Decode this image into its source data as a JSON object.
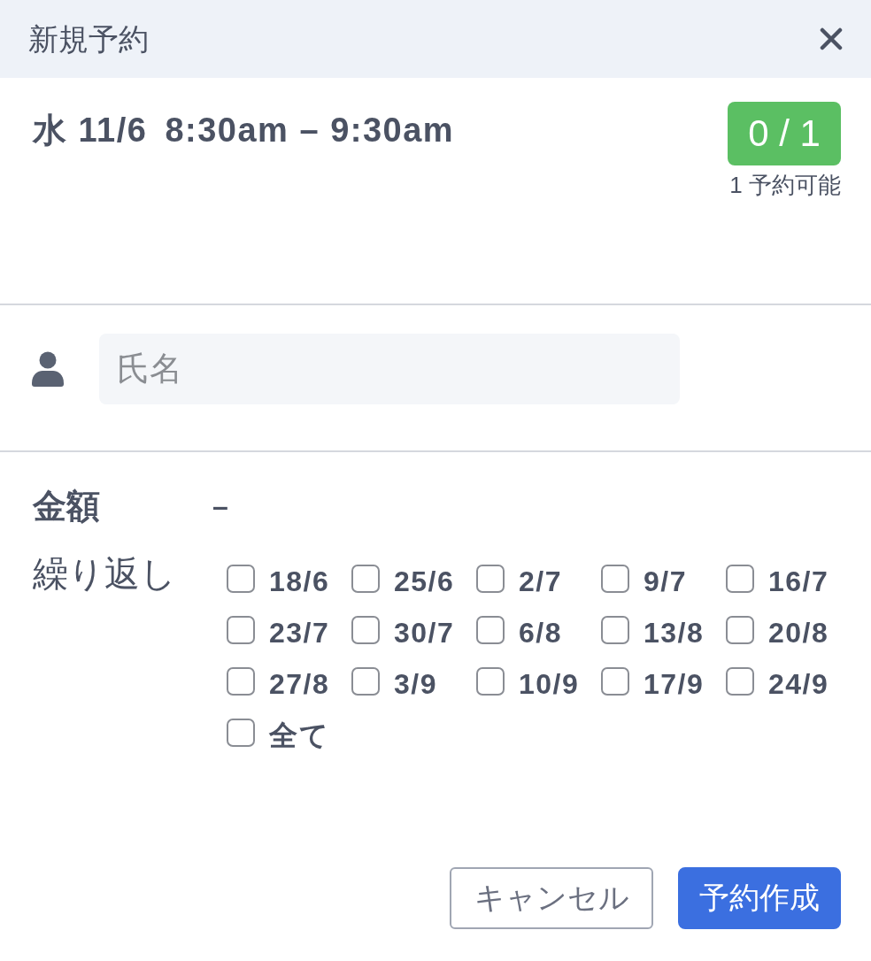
{
  "dialog": {
    "title": "新規予約"
  },
  "slot": {
    "date": "水 11/6",
    "time": "8:30am – 9:30am",
    "capacity": {
      "count": "0 / 1",
      "note": "1 予約可能"
    }
  },
  "name_field": {
    "placeholder": "氏名"
  },
  "amount": {
    "label": "金額",
    "value": "–"
  },
  "repeat": {
    "label": "繰り返し",
    "options": [
      {
        "label": "18/6",
        "checked": false
      },
      {
        "label": "25/6",
        "checked": false
      },
      {
        "label": "2/7",
        "checked": false
      },
      {
        "label": "9/7",
        "checked": false
      },
      {
        "label": "16/7",
        "checked": false
      },
      {
        "label": "23/7",
        "checked": false
      },
      {
        "label": "30/7",
        "checked": false
      },
      {
        "label": "6/8",
        "checked": false
      },
      {
        "label": "13/8",
        "checked": false
      },
      {
        "label": "20/8",
        "checked": false
      },
      {
        "label": "27/8",
        "checked": false
      },
      {
        "label": "3/9",
        "checked": false
      },
      {
        "label": "10/9",
        "checked": false
      },
      {
        "label": "17/9",
        "checked": false
      },
      {
        "label": "24/9",
        "checked": false
      },
      {
        "label": "全て",
        "checked": false
      }
    ]
  },
  "buttons": [
    {
      "label": "キャンセル",
      "kind": "secondary"
    },
    {
      "label": "予約作成",
      "kind": "primary"
    }
  ]
}
